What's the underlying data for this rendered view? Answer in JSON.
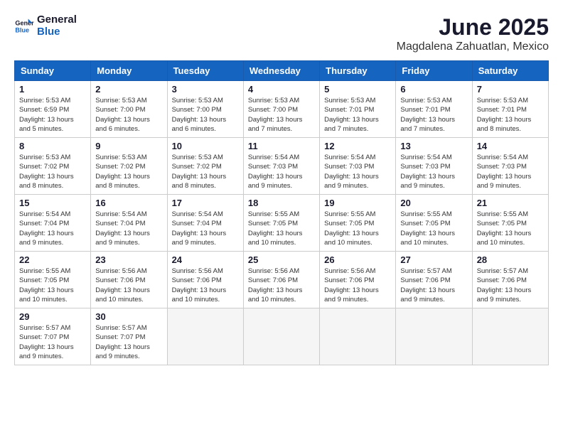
{
  "logo": {
    "line1": "General",
    "line2": "Blue"
  },
  "title": "June 2025",
  "location": "Magdalena Zahuatlan, Mexico",
  "weekdays": [
    "Sunday",
    "Monday",
    "Tuesday",
    "Wednesday",
    "Thursday",
    "Friday",
    "Saturday"
  ],
  "weeks": [
    [
      {
        "day": "1",
        "info": "Sunrise: 5:53 AM\nSunset: 6:59 PM\nDaylight: 13 hours\nand 5 minutes."
      },
      {
        "day": "2",
        "info": "Sunrise: 5:53 AM\nSunset: 7:00 PM\nDaylight: 13 hours\nand 6 minutes."
      },
      {
        "day": "3",
        "info": "Sunrise: 5:53 AM\nSunset: 7:00 PM\nDaylight: 13 hours\nand 6 minutes."
      },
      {
        "day": "4",
        "info": "Sunrise: 5:53 AM\nSunset: 7:00 PM\nDaylight: 13 hours\nand 7 minutes."
      },
      {
        "day": "5",
        "info": "Sunrise: 5:53 AM\nSunset: 7:01 PM\nDaylight: 13 hours\nand 7 minutes."
      },
      {
        "day": "6",
        "info": "Sunrise: 5:53 AM\nSunset: 7:01 PM\nDaylight: 13 hours\nand 7 minutes."
      },
      {
        "day": "7",
        "info": "Sunrise: 5:53 AM\nSunset: 7:01 PM\nDaylight: 13 hours\nand 8 minutes."
      }
    ],
    [
      {
        "day": "8",
        "info": "Sunrise: 5:53 AM\nSunset: 7:02 PM\nDaylight: 13 hours\nand 8 minutes."
      },
      {
        "day": "9",
        "info": "Sunrise: 5:53 AM\nSunset: 7:02 PM\nDaylight: 13 hours\nand 8 minutes."
      },
      {
        "day": "10",
        "info": "Sunrise: 5:53 AM\nSunset: 7:02 PM\nDaylight: 13 hours\nand 8 minutes."
      },
      {
        "day": "11",
        "info": "Sunrise: 5:54 AM\nSunset: 7:03 PM\nDaylight: 13 hours\nand 9 minutes."
      },
      {
        "day": "12",
        "info": "Sunrise: 5:54 AM\nSunset: 7:03 PM\nDaylight: 13 hours\nand 9 minutes."
      },
      {
        "day": "13",
        "info": "Sunrise: 5:54 AM\nSunset: 7:03 PM\nDaylight: 13 hours\nand 9 minutes."
      },
      {
        "day": "14",
        "info": "Sunrise: 5:54 AM\nSunset: 7:03 PM\nDaylight: 13 hours\nand 9 minutes."
      }
    ],
    [
      {
        "day": "15",
        "info": "Sunrise: 5:54 AM\nSunset: 7:04 PM\nDaylight: 13 hours\nand 9 minutes."
      },
      {
        "day": "16",
        "info": "Sunrise: 5:54 AM\nSunset: 7:04 PM\nDaylight: 13 hours\nand 9 minutes."
      },
      {
        "day": "17",
        "info": "Sunrise: 5:54 AM\nSunset: 7:04 PM\nDaylight: 13 hours\nand 9 minutes."
      },
      {
        "day": "18",
        "info": "Sunrise: 5:55 AM\nSunset: 7:05 PM\nDaylight: 13 hours\nand 10 minutes."
      },
      {
        "day": "19",
        "info": "Sunrise: 5:55 AM\nSunset: 7:05 PM\nDaylight: 13 hours\nand 10 minutes."
      },
      {
        "day": "20",
        "info": "Sunrise: 5:55 AM\nSunset: 7:05 PM\nDaylight: 13 hours\nand 10 minutes."
      },
      {
        "day": "21",
        "info": "Sunrise: 5:55 AM\nSunset: 7:05 PM\nDaylight: 13 hours\nand 10 minutes."
      }
    ],
    [
      {
        "day": "22",
        "info": "Sunrise: 5:55 AM\nSunset: 7:05 PM\nDaylight: 13 hours\nand 10 minutes."
      },
      {
        "day": "23",
        "info": "Sunrise: 5:56 AM\nSunset: 7:06 PM\nDaylight: 13 hours\nand 10 minutes."
      },
      {
        "day": "24",
        "info": "Sunrise: 5:56 AM\nSunset: 7:06 PM\nDaylight: 13 hours\nand 10 minutes."
      },
      {
        "day": "25",
        "info": "Sunrise: 5:56 AM\nSunset: 7:06 PM\nDaylight: 13 hours\nand 10 minutes."
      },
      {
        "day": "26",
        "info": "Sunrise: 5:56 AM\nSunset: 7:06 PM\nDaylight: 13 hours\nand 9 minutes."
      },
      {
        "day": "27",
        "info": "Sunrise: 5:57 AM\nSunset: 7:06 PM\nDaylight: 13 hours\nand 9 minutes."
      },
      {
        "day": "28",
        "info": "Sunrise: 5:57 AM\nSunset: 7:06 PM\nDaylight: 13 hours\nand 9 minutes."
      }
    ],
    [
      {
        "day": "29",
        "info": "Sunrise: 5:57 AM\nSunset: 7:07 PM\nDaylight: 13 hours\nand 9 minutes."
      },
      {
        "day": "30",
        "info": "Sunrise: 5:57 AM\nSunset: 7:07 PM\nDaylight: 13 hours\nand 9 minutes."
      },
      {
        "day": "",
        "info": ""
      },
      {
        "day": "",
        "info": ""
      },
      {
        "day": "",
        "info": ""
      },
      {
        "day": "",
        "info": ""
      },
      {
        "day": "",
        "info": ""
      }
    ]
  ]
}
